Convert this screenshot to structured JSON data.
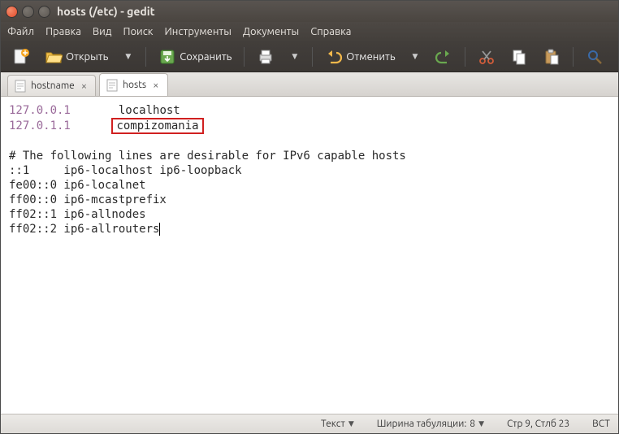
{
  "window": {
    "title": "hosts (/etc) - gedit"
  },
  "menu": {
    "file": "Файл",
    "edit": "Правка",
    "view": "Вид",
    "search": "Поиск",
    "tools": "Инструменты",
    "documents": "Документы",
    "help": "Справка"
  },
  "toolbar": {
    "open": "Открыть",
    "save": "Сохранить",
    "undo": "Отменить"
  },
  "tabs": [
    {
      "name": "hostname",
      "active": false
    },
    {
      "name": "hosts",
      "active": true
    }
  ],
  "editor": {
    "lines": [
      {
        "ip": "127.0.0.1",
        "host": "localhost"
      },
      {
        "ip": "127.0.1.1",
        "host": "compizomania",
        "highlight": true
      }
    ],
    "comment": "# The following lines are desirable for IPv6 capable hosts",
    "ipv6": [
      "::1     ip6-localhost ip6-loopback",
      "fe00::0 ip6-localnet",
      "ff00::0 ip6-mcastprefix",
      "ff02::1 ip6-allnodes",
      "ff02::2 ip6-allrouters"
    ]
  },
  "status": {
    "syntax": "Текст",
    "tabwidth_label": "Ширина табуляции:",
    "tabwidth_value": "8",
    "position": "Стр 9, Стлб 23",
    "insert_mode": "ВСТ"
  }
}
